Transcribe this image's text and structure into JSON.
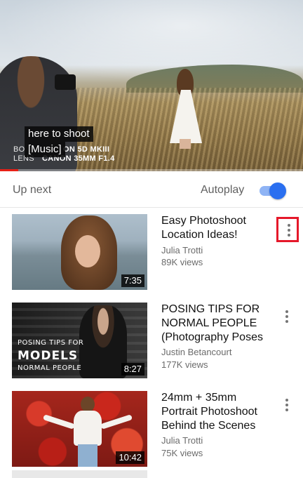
{
  "player": {
    "captions": [
      "here to shoot",
      "[Music]"
    ],
    "burn_in": {
      "line1_label": "BO",
      "line1_value": "ON 5D MKIII",
      "line2_label": "LENS",
      "line2_value": "CANON 35MM F1.4"
    },
    "progress": 0.06,
    "progress_color": "#e62117"
  },
  "up_next": {
    "label": "Up next",
    "autoplay_label": "Autoplay",
    "autoplay_on": true,
    "toggle_color": "#2a6ff0"
  },
  "videos": [
    {
      "title": "Easy Photoshoot\nLocation Ideas!",
      "channel": "Julia Trotti",
      "views": "89K views",
      "duration": "7:35",
      "menu_icon": "more-vert-icon"
    },
    {
      "title": "POSING TIPS FOR\nNORMAL PEOPLE\n(Photography Poses",
      "channel": "Justin Betancourt",
      "views": "177K views",
      "duration": "8:27",
      "thumb_text": [
        "POSING TIPS FOR",
        "MODELS",
        "NORMAL PEOPLE"
      ],
      "menu_icon": "more-vert-icon"
    },
    {
      "title": "24mm + 35mm\nPortrait Photoshoot\nBehind the Scenes",
      "channel": "Julia Trotti",
      "views": "75K views",
      "duration": "10:42",
      "menu_icon": "more-vert-icon"
    }
  ]
}
